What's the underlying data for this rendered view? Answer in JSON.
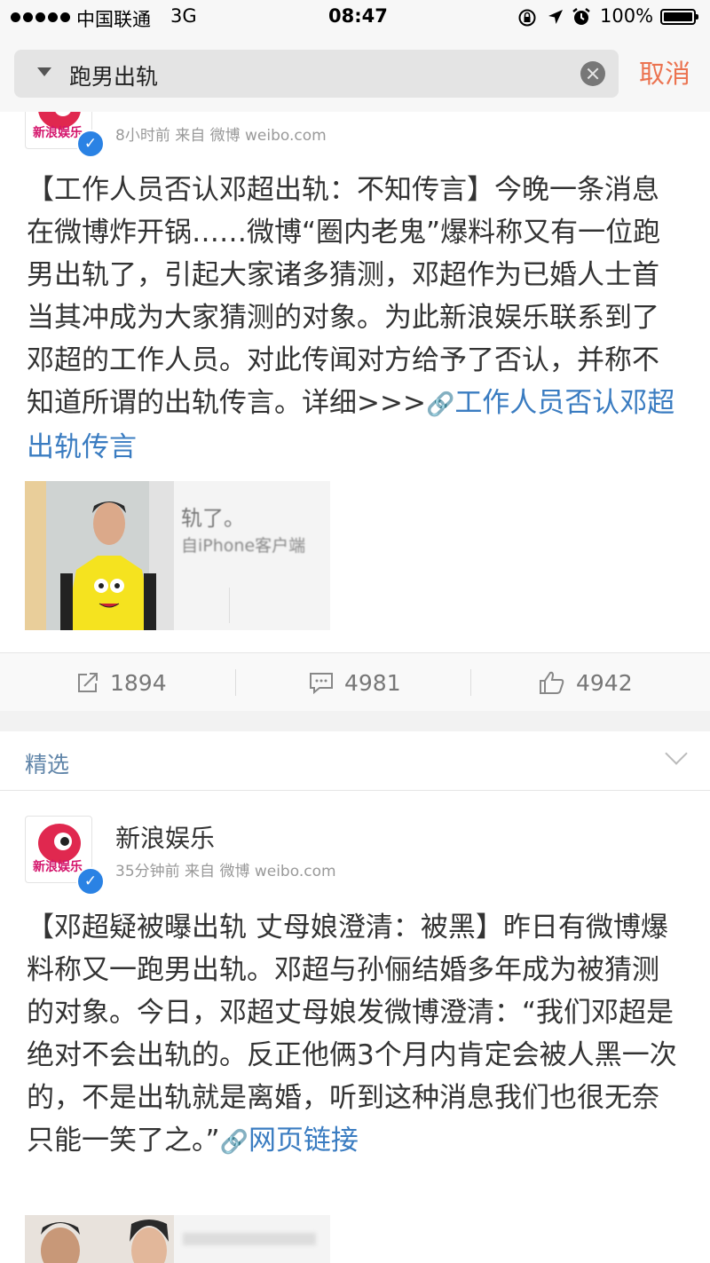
{
  "status_bar": {
    "carrier": "中国联通",
    "network": "3G",
    "time": "08:47",
    "battery": "100%"
  },
  "search": {
    "query": "跑男出轨",
    "cancel_label": "取消"
  },
  "posts": [
    {
      "author": "",
      "avatar_text": "新浪娱乐",
      "meta": "8小时前  来自 微博 weibo.com",
      "text": "【工作人员否认邓超出轨：不知传言】今晚一条消息在微博炸开锅……微博“圈内老鬼”爆料称又有一位跑男出轨了，引起大家诸多猜测，邓超作为已婚人士首当其冲成为大家猜测的对象。为此新浪娱乐联系到了邓超的工作人员。对此传闻对方给予了否认，并称不知道所谓的出轨传言。详细>>>",
      "link_text": "工作人员否认邓超出轨传言",
      "image_text": [
        "轨了。",
        "自iPhone客户端"
      ],
      "reposts": "1894",
      "comments": "4981",
      "likes": "4942"
    },
    {
      "author": "新浪娱乐",
      "avatar_text": "新浪娱乐",
      "meta": "35分钟前  来自 微博 weibo.com",
      "text": "【邓超疑被曝出轨 丈母娘澄清：被黑】昨日有微博爆料称又一跑男出轨。邓超与孙俪结婚多年成为被猜测的对象。今日，邓超丈母娘发微博澄清：“我们邓超是绝对不会出轨的。反正他俩3个月内肯定会被人黑一次的，不是出轨就是离婚，听到这种消息我们也很无奈只能一笑了之。”",
      "link_text": "网页链接"
    }
  ],
  "section": {
    "title": "精选"
  },
  "colors": {
    "accent": "#eb7350",
    "link": "#3a7cc1",
    "verified": "#2a82e4",
    "section_title": "#5f84a8"
  }
}
